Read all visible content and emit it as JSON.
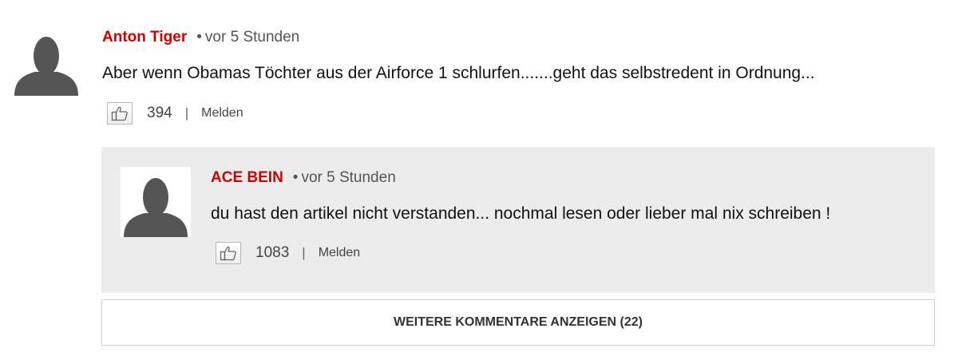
{
  "comments": [
    {
      "author": "Anton Tiger",
      "time": "vor 5 Stunden",
      "text": "Aber wenn Obamas Töchter aus der Airforce 1 schlurfen.......geht das selbstredent in Ordnung...",
      "likes": "394",
      "report_label": "Melden"
    }
  ],
  "replies": [
    {
      "author": "ACE BEIN",
      "time": "vor 5 Stunden",
      "text": "du hast den artikel nicht verstanden... nochmal lesen oder lieber mal nix schreiben !",
      "likes": "1083",
      "report_label": "Melden"
    }
  ],
  "separator": "|",
  "bullet": "•",
  "load_more_label": "WEITERE KOMMENTARE ANZEIGEN (22)",
  "colors": {
    "author": "#cc0000",
    "reply_background": "#ececec",
    "avatar_silhouette": "#555555"
  },
  "icons": {
    "avatar": "user-silhouette-icon",
    "like": "thumbs-up-icon"
  }
}
